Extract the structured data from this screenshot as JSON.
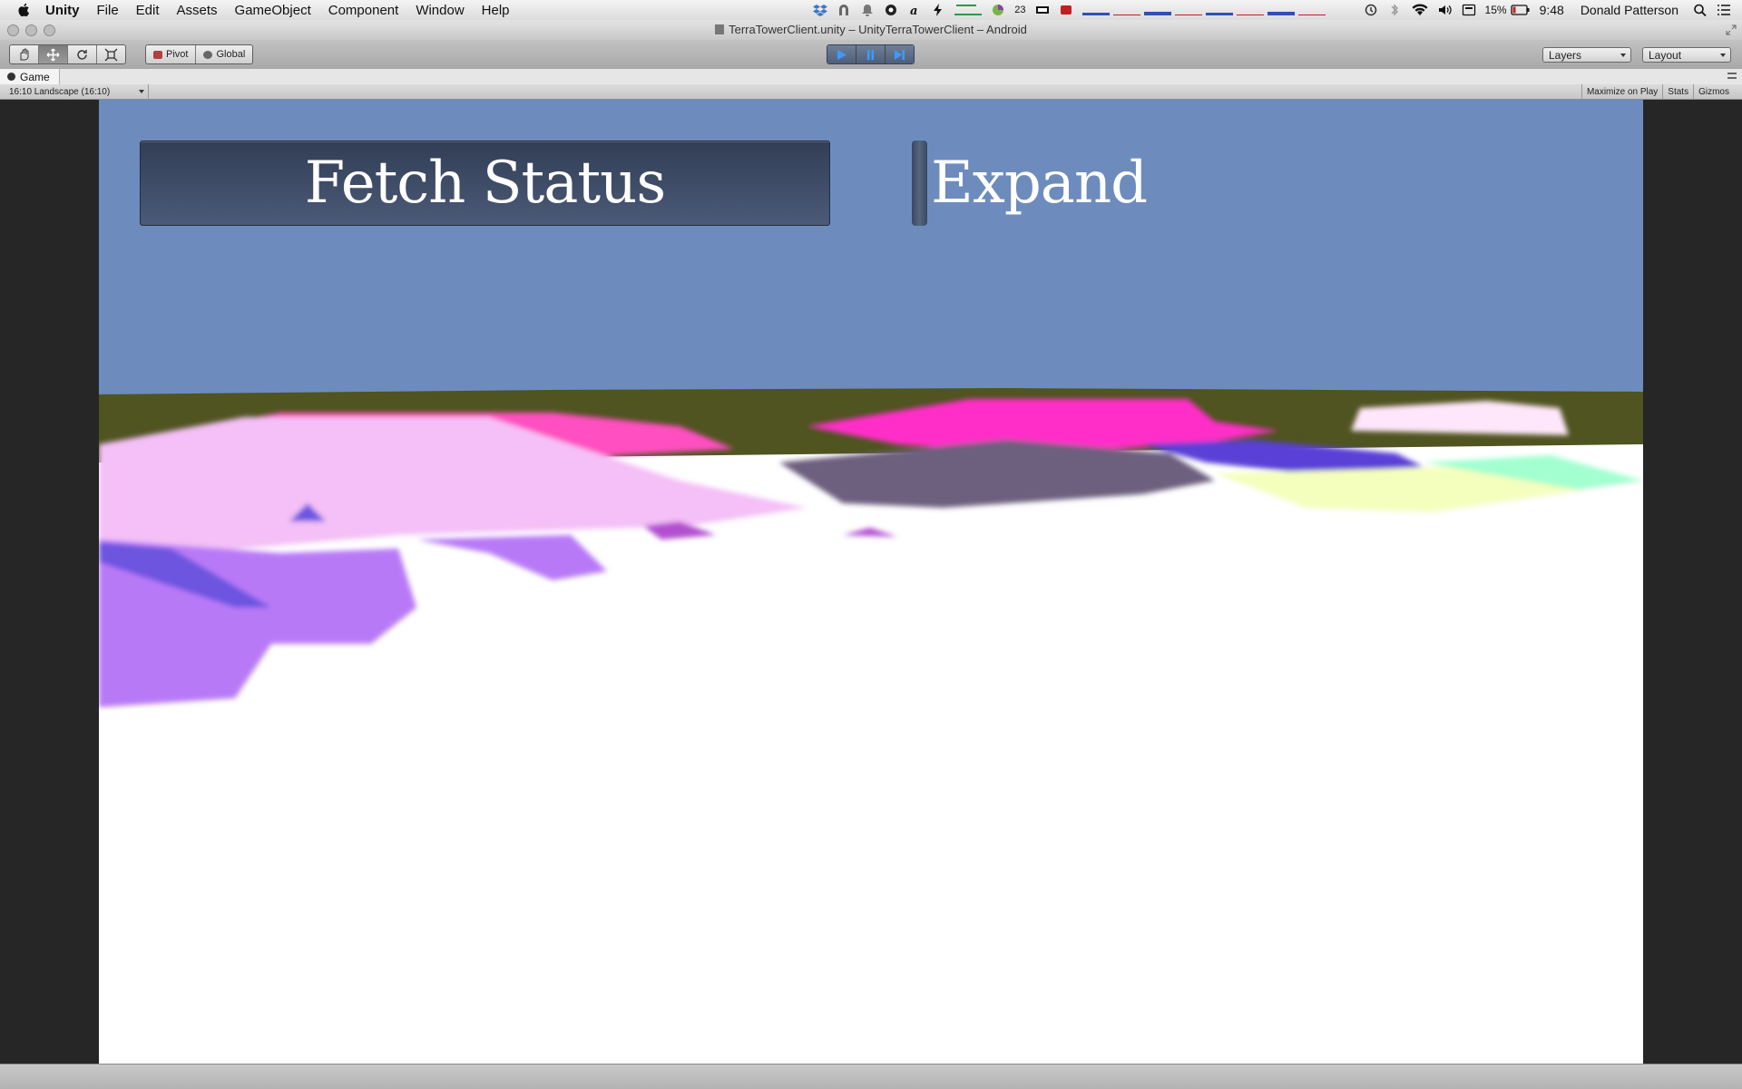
{
  "menubar": {
    "app_name": "Unity",
    "items": [
      "File",
      "Edit",
      "Assets",
      "GameObject",
      "Component",
      "Window",
      "Help"
    ],
    "battery": "15%",
    "clock": "9:48",
    "user": "Donald Patterson",
    "calendar_badge": "23"
  },
  "window": {
    "title": "TerraTowerClient.unity – UnityTerraTowerClient – Android"
  },
  "toolbar": {
    "pivot_label": "Pivot",
    "global_label": "Global",
    "layers_label": "Layers",
    "layout_label": "Layout"
  },
  "game_tab": {
    "label": "Game",
    "aspect": "16:10 Landscape (16:10)",
    "maximize_label": "Maximize on Play",
    "stats_label": "Stats",
    "gizmos_label": "Gizmos"
  },
  "game": {
    "fetch_button": "Fetch Status",
    "expand_toggle": "Expand",
    "expand_checked": false,
    "sky_color": "#6d8cbd",
    "ground_color": "#4f5420"
  }
}
